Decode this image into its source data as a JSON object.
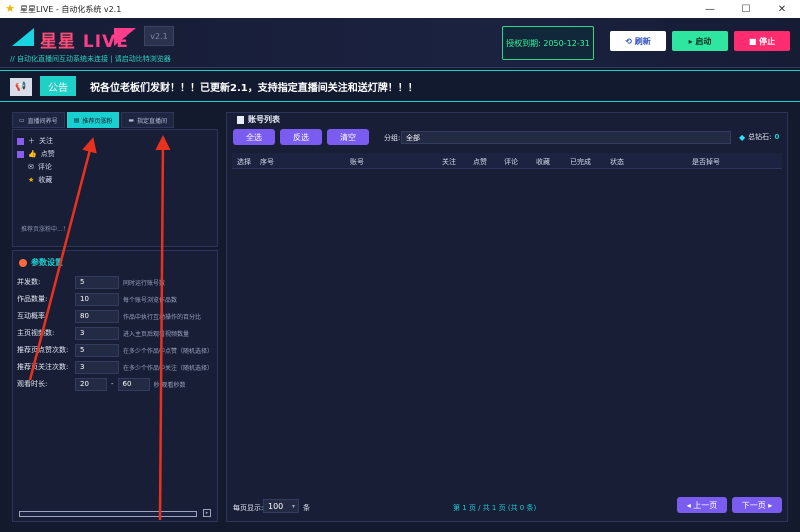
{
  "window": {
    "title": "星星LIVE - 自动化系统 v2.1",
    "app_icon": "star-icon",
    "controls": {
      "minimize": "—",
      "maximize": "☐",
      "close": "✕"
    }
  },
  "header": {
    "logo_cn": "星星",
    "logo_en": "LIVE",
    "version": "v2.1",
    "subtitle": "// 自动化直播间互动系统未连接 | 请启动比特浏览器",
    "license": "授权到期: 2050-12-31",
    "buttons": {
      "refresh": "⟲ 刷新",
      "start": "▸ 启动",
      "stop": "■ 停止"
    }
  },
  "announcement": {
    "icon": "📢",
    "tag": "公告",
    "text": "祝各位老板们发财！！！已更新2.1，支持指定直播间关注和送灯牌！！！"
  },
  "left": {
    "tabs": [
      {
        "label": "直播间养号",
        "icon": "tv-icon",
        "active": false
      },
      {
        "label": "推荐页涨粉",
        "icon": "doc-icon",
        "active": true
      },
      {
        "label": "指定直播间",
        "icon": "monitor-icon",
        "active": false
      }
    ],
    "tasks": [
      {
        "label": "关注",
        "icon": "＋"
      },
      {
        "label": "点赞",
        "icon": "👍"
      },
      {
        "label": "评论",
        "icon": "✉"
      },
      {
        "label": "收藏",
        "icon": "★"
      }
    ],
    "task_note": "推荐页涨粉中...！",
    "params": {
      "title": "参数设置",
      "rows": [
        {
          "label": "并发数:",
          "value": "5",
          "desc": "同时运行账号数"
        },
        {
          "label": "作品数量:",
          "value": "10",
          "desc": "每个账号浏览作品数"
        },
        {
          "label": "互动概率:",
          "value": "80",
          "desc": "作品中执行互动操作的百分比"
        },
        {
          "label": "主页视频数:",
          "value": "3",
          "desc": "进入主页后观看视频数量"
        },
        {
          "label": "推荐页点赞次数:",
          "value": "5",
          "desc": "在多少个作品中点赞（随机选择）"
        },
        {
          "label": "推荐页关注次数:",
          "value": "3",
          "desc": "在多少个作品中关注（随机选择）"
        }
      ],
      "watch": {
        "label": "观看时长:",
        "min": "20",
        "sep": "-",
        "max": "60",
        "unit": "秒 观看秒数"
      }
    },
    "scroll_btn": "▸"
  },
  "right": {
    "title": "账号列表",
    "buttons": {
      "select_all": "全选",
      "invert": "反选",
      "clear": "清空"
    },
    "group_label": "分组:",
    "group_value": "全部",
    "diamond_label": "总钻石:",
    "diamond_value": "0",
    "columns": [
      "选择",
      "序号",
      "账号",
      "关注",
      "点赞",
      "评论",
      "收藏",
      "已完成",
      "状态",
      "是否掉号"
    ],
    "footer": {
      "per_page_label": "每页显示:",
      "per_page_value": "100",
      "per_page_unit": "条",
      "page_info": "第 1 页 / 共 1 页 (共 0 条)",
      "prev": "◂ 上一页",
      "next": "下一页 ▸"
    }
  },
  "colors": {
    "accent_cyan": "#19d0d0",
    "accent_pink": "#ff3d8b",
    "accent_purple": "#7a5cf0",
    "license_green": "#33f5a0",
    "annotation_red": "#e8321e"
  }
}
